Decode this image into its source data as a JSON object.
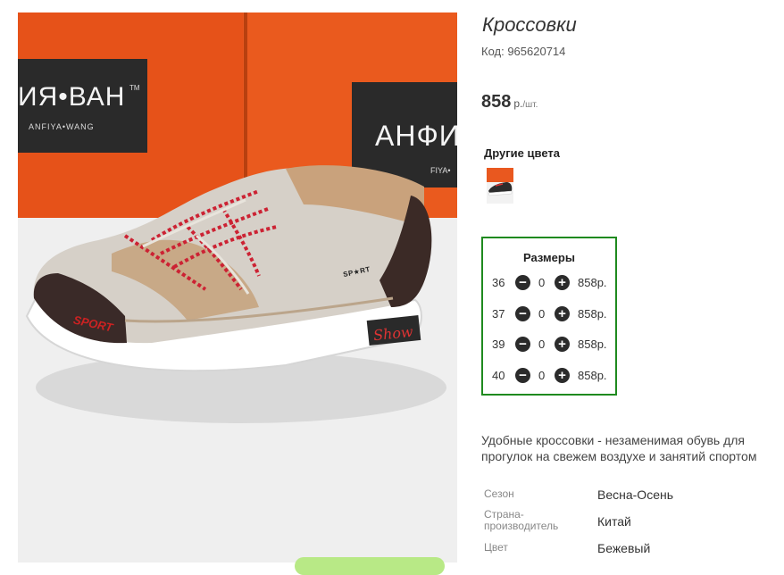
{
  "product": {
    "title": "Кроссовки",
    "code": "Код: 965620714",
    "price": "858",
    "price_unit": "р.",
    "price_per": "/шт.",
    "image_brand_left": "ИЯ•ВАН",
    "image_brand_left_sub": "ANFIYA•WANG",
    "image_brand_left_tm": "TM",
    "image_brand_right": "АНФИ",
    "image_brand_right_sub": "FIYA•",
    "image_sport_tag": "SP★RT",
    "image_heel_sport": "SPORT",
    "image_heel_show": "Show"
  },
  "other_colors": {
    "label": "Другие цвета"
  },
  "sizes": {
    "title": "Размеры",
    "rows": [
      {
        "size": "36",
        "qty": "0",
        "price": "858р."
      },
      {
        "size": "37",
        "qty": "0",
        "price": "858р."
      },
      {
        "size": "39",
        "qty": "0",
        "price": "858р."
      },
      {
        "size": "40",
        "qty": "0",
        "price": "858р."
      }
    ],
    "minus_symbol": "−",
    "plus_symbol": "+"
  },
  "description": "Удобные кроссовки - незаменимая обувь для прогулок на свежем воздухе и занятий спортом",
  "attributes": [
    {
      "label": "Сезон",
      "value": "Весна-Осень"
    },
    {
      "label": "Страна-\nпроизводитель",
      "value": "Китай"
    },
    {
      "label": "Цвет",
      "value": "Бежевый"
    }
  ],
  "colors": {
    "accent_border": "#1f8a1f",
    "box_orange": "#e9581f",
    "button_green": "#b8e986"
  }
}
